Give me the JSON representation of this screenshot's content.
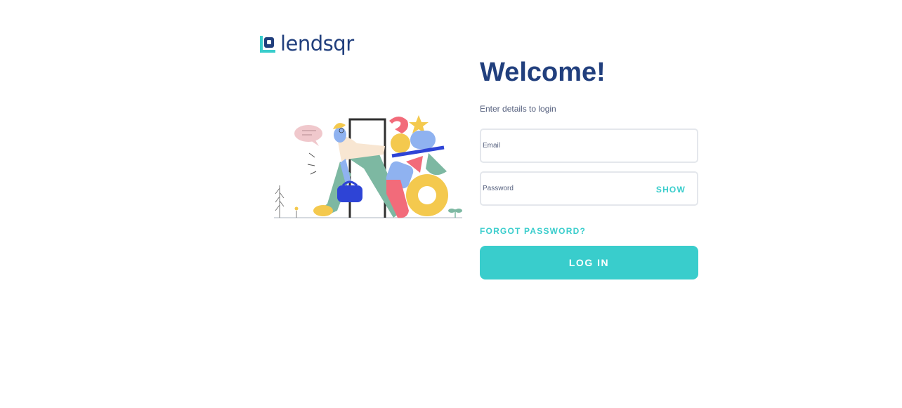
{
  "brand": {
    "name": "lendsqr",
    "logo_icon": "lendsqr-logo-icon"
  },
  "colors": {
    "brand": "#213F7D",
    "accent": "#39CDCC",
    "muted": "#545F7D",
    "border": "#E4E7EC"
  },
  "illustration": {
    "name": "person-walking-through-door-illustration"
  },
  "login": {
    "title": "Welcome!",
    "subtitle": "Enter details to login",
    "email_placeholder": "Email",
    "password_placeholder": "Password",
    "show_label": "SHOW",
    "forgot_label": "FORGOT PASSWORD?",
    "submit_label": "LOG IN"
  }
}
